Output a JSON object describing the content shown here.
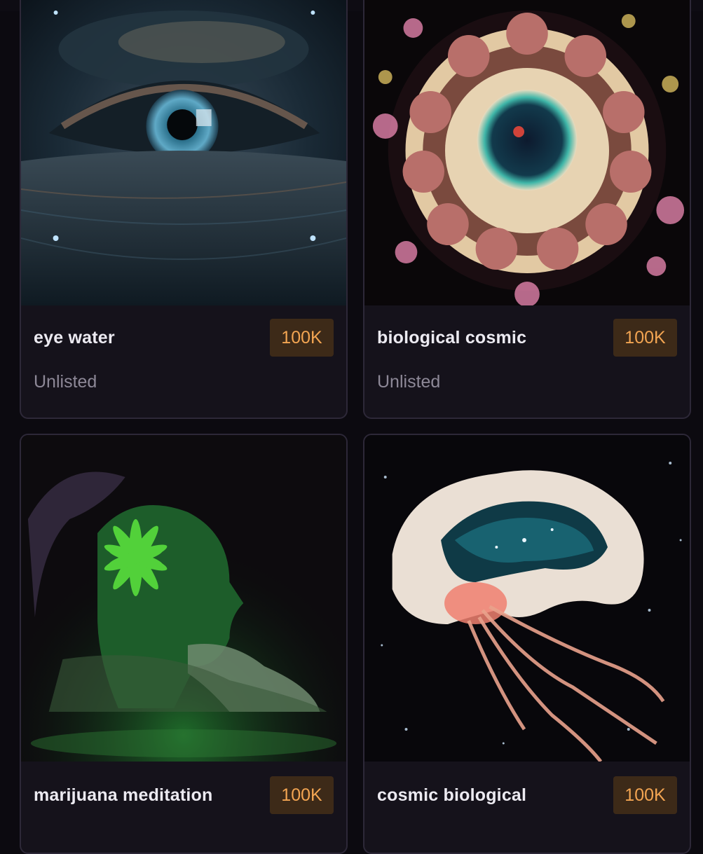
{
  "cards": [
    {
      "title": "eye water",
      "badge": "100K",
      "status": "Unlisted",
      "image": "cosmic-eye-artwork"
    },
    {
      "title": "biological cosmic",
      "badge": "100K",
      "status": "Unlisted",
      "image": "cell-mandala-artwork"
    },
    {
      "title": "marijuana meditation",
      "badge": "100K",
      "image": "green-profile-artwork"
    },
    {
      "title": "cosmic biological",
      "badge": "100K",
      "image": "brain-jellyfish-artwork"
    }
  ],
  "colors": {
    "background": "#0c0a10",
    "card": "#15121b",
    "card_border": "#2d2838",
    "badge_bg": "#3d2a18",
    "badge_text": "#f3a552",
    "status_text": "#8d8897"
  }
}
